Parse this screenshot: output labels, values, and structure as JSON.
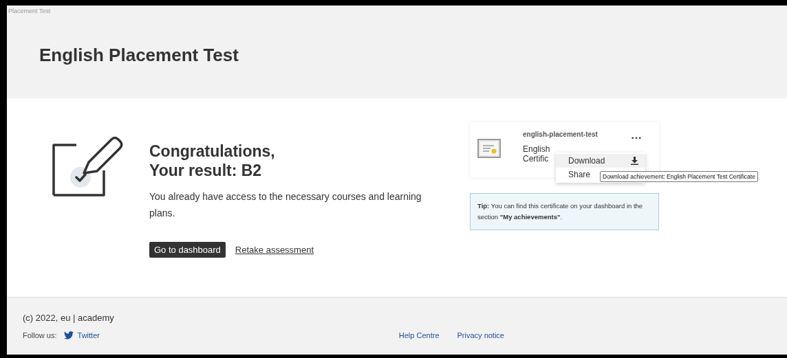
{
  "header": {
    "breadcrumb": "Placement Test",
    "title": "English Placement Test"
  },
  "result": {
    "heading_lines": [
      "Congratulations,",
      "Your result: B2"
    ],
    "text": "You already have access to the necessary courses and learning plans.",
    "primary_button": "Go to dashboard",
    "secondary_link": "Retake assessment"
  },
  "achievement_card": {
    "slug": "english-placement-test",
    "title_visible": [
      "English",
      "Certific"
    ],
    "more_button": "•••"
  },
  "menu": {
    "items": [
      {
        "label": "Download",
        "selected": true
      },
      {
        "label": "Share",
        "selected": false
      }
    ]
  },
  "tooltip": "Download achievement: English Placement Test Certificate",
  "tip": "**Tip:** You can find this certificate on your dashboard in the section **\"My achievements\"**.",
  "footer": {
    "copyright": "(c) 2022, eu | academy",
    "follow_label": "Follow us:",
    "twitter": "Twitter",
    "links": [
      "Help Centre",
      "Privacy notice"
    ]
  }
}
